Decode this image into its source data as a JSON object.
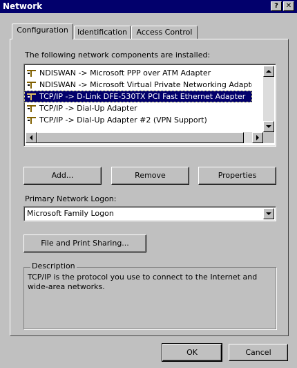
{
  "window": {
    "title": "Network",
    "help_label": "?",
    "close_label": "✕"
  },
  "tabs": [
    {
      "label": "Configuration"
    },
    {
      "label": "Identification"
    },
    {
      "label": "Access Control"
    }
  ],
  "components": {
    "heading": "The following network components are installed:",
    "items": [
      {
        "text": "NDISWAN -> Microsoft PPP over ATM Adapter",
        "selected": false
      },
      {
        "text": "NDISWAN -> Microsoft Virtual Private Networking Adapter",
        "selected": false
      },
      {
        "text": "TCP/IP -> D-Link DFE-530TX PCI Fast Ethernet Adapter",
        "selected": true
      },
      {
        "text": "TCP/IP -> Dial-Up Adapter",
        "selected": false
      },
      {
        "text": "TCP/IP -> Dial-Up Adapter #2 (VPN Support)",
        "selected": false
      }
    ]
  },
  "buttons": {
    "add": "Add...",
    "remove": "Remove",
    "properties": "Properties",
    "file_print": "File and Print Sharing...",
    "ok": "OK",
    "cancel": "Cancel"
  },
  "logon": {
    "label": "Primary Network Logon:",
    "value": "Microsoft Family Logon"
  },
  "description": {
    "title": "Description",
    "text": "TCP/IP is the protocol you use to connect to the Internet and wide-area networks."
  },
  "colors": {
    "titlebar": "#02006c",
    "selection": "#02006c",
    "face": "#c0c0c0"
  }
}
